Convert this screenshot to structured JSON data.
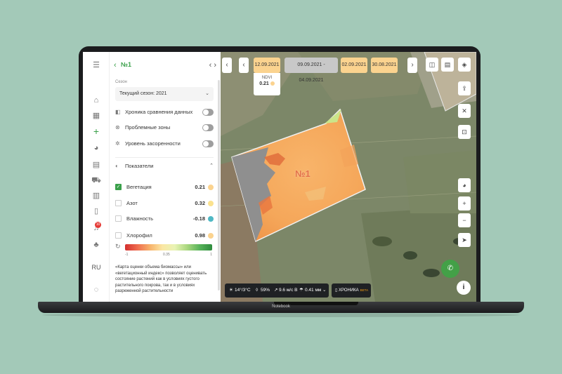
{
  "device": {
    "label": "Notebook"
  },
  "rail": {
    "items": [
      {
        "icon": "menu-icon",
        "glyph": "☰"
      },
      {
        "icon": "home-icon",
        "glyph": "⌂"
      },
      {
        "icon": "grid-icon",
        "glyph": "▦"
      },
      {
        "icon": "add-icon",
        "glyph": "+"
      },
      {
        "icon": "globe-icon",
        "glyph": "◕"
      },
      {
        "icon": "stack-icon",
        "glyph": "▤"
      },
      {
        "icon": "tractor-icon",
        "glyph": "⛟"
      },
      {
        "icon": "building-icon",
        "glyph": "▥"
      },
      {
        "icon": "phone-device-icon",
        "glyph": "▯"
      },
      {
        "icon": "bell-icon",
        "glyph": "♫"
      },
      {
        "icon": "sprout-icon",
        "glyph": "♣"
      },
      {
        "icon": "chat-icon",
        "glyph": "◌"
      }
    ],
    "badge": "10",
    "lang": "RU"
  },
  "panel": {
    "field_number": "№1",
    "season_label": "Сезон",
    "season_value": "Текущий сезон: 2021",
    "toggles": [
      {
        "label": "Хроника сравнения данных",
        "on": false
      },
      {
        "label": "Проблемные зоны",
        "on": false
      },
      {
        "label": "Уровень засоренности",
        "on": false
      }
    ],
    "indicators_title": "Показатели",
    "indicators": [
      {
        "label": "Вегетация",
        "value": "0.21",
        "checked": true,
        "color": "#fbd38f"
      },
      {
        "label": "Азот",
        "value": "0.32",
        "checked": false,
        "color": "#fbe28f"
      },
      {
        "label": "Влажность",
        "value": "-0.18",
        "checked": false,
        "color": "#4fb8c4"
      },
      {
        "label": "Хлорофил",
        "value": "0.98",
        "checked": false,
        "color": "#fbd38f"
      }
    ],
    "scale_labels": [
      "-1",
      "0.35",
      "1"
    ],
    "description": "«Карта оценки объема биомассы» или «вегетационный индекс» позволяет оценивать состояние растений как в условиях густого растительного покрова, так и в условиях разреженной растительности"
  },
  "map": {
    "dates": {
      "active": "12.09.2021",
      "range": "09.09.2021 - 04.09.2021",
      "other1": "02.09.2021",
      "other2": "30.08.2021"
    },
    "ndvi": {
      "label": "NDVI",
      "value": "0.21"
    },
    "field_label": "№1",
    "weather": {
      "temp": "14°/3°C",
      "humidity": "59%",
      "wind": "9.6 м/с В",
      "rain": "0.41 мм"
    },
    "chronicle": {
      "label": "ХРОНИКА",
      "badge": "BETA"
    }
  },
  "colors": {
    "accent": "#3aa04a",
    "field": "#f6b064",
    "soil": "#9a9a9a"
  }
}
